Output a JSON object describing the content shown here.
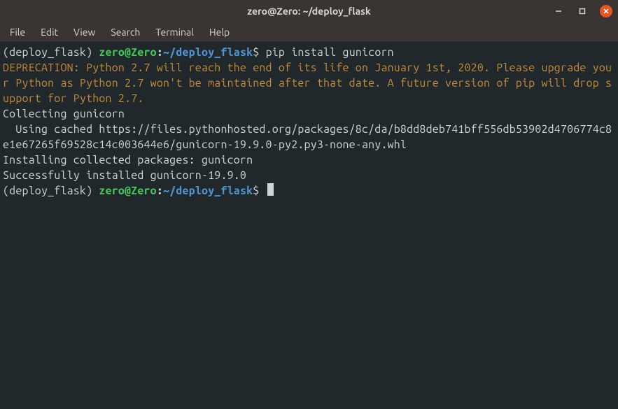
{
  "window": {
    "title": "zero@Zero: ~/deploy_flask"
  },
  "menu": {
    "items": [
      "File",
      "Edit",
      "View",
      "Search",
      "Terminal",
      "Help"
    ]
  },
  "prompt1": {
    "venv": "(deploy_flask) ",
    "user": "zero@Zero",
    "colon": ":",
    "path": "~/deploy_flask",
    "dollar": "$ ",
    "command": "pip install gunicorn"
  },
  "output": {
    "deprecation": "DEPRECATION: Python 2.7 will reach the end of its life on January 1st, 2020. Please upgrade your Python as Python 2.7 won't be maintained after that date. A future version of pip will drop support for Python 2.7.",
    "line1": "Collecting gunicorn",
    "line2": "  Using cached https://files.pythonhosted.org/packages/8c/da/b8dd8deb741bff556db53902d4706774c8e1e67265f69528c14c003644e6/gunicorn-19.9.0-py2.py3-none-any.whl",
    "line3": "Installing collected packages: gunicorn",
    "line4": "Successfully installed gunicorn-19.9.0"
  },
  "prompt2": {
    "venv": "(deploy_flask) ",
    "user": "zero@Zero",
    "colon": ":",
    "path": "~/deploy_flask",
    "dollar": "$ "
  }
}
